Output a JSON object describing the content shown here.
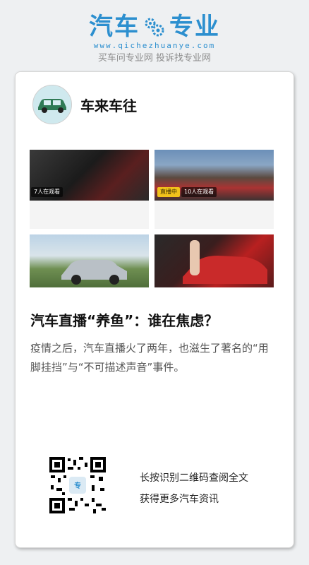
{
  "header": {
    "brand_left": "汽车",
    "brand_right": "专业",
    "url": "www.qichezhuanye.com",
    "slogan": "买车问专业网 投诉找专业网",
    "brand_color": "#2c8fcf"
  },
  "author": {
    "name": "车来车往",
    "avatar_icon": "green-car-icon"
  },
  "thumbnails": {
    "thumb1_viewers": "7人在观看",
    "thumb2_live": "直播中",
    "thumb2_viewers": "10人在观看"
  },
  "article": {
    "title": "汽车直播“养鱼”：谁在焦虑？",
    "summary": "疫情之后，汽车直播火了两年，也滋生了著名的“用脚挂挡”与“不可描述声音”事件。"
  },
  "qr": {
    "line1": "长按识别二维码查阅全文",
    "line2": "获得更多汽车资讯",
    "icon": "qr-code-icon"
  }
}
